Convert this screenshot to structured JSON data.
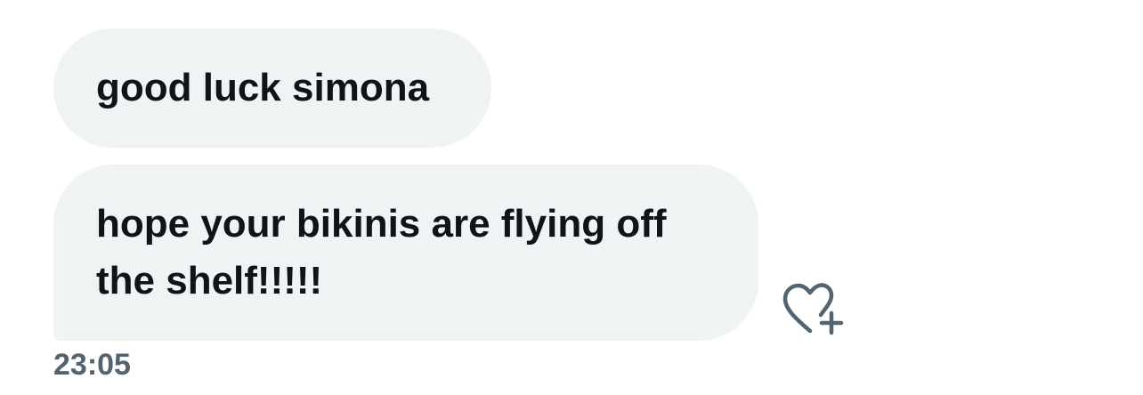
{
  "messages": [
    {
      "text": "good luck simona"
    },
    {
      "text": "hope your bikinis are flying off the shelf!!!!!"
    }
  ],
  "timestamp": "23:05",
  "reaction_button": {
    "icon": "heart-plus-icon"
  },
  "colors": {
    "bubble_background": "#eff3f4",
    "text": "#0f1419",
    "timestamp": "#536471",
    "icon": "#536471"
  }
}
